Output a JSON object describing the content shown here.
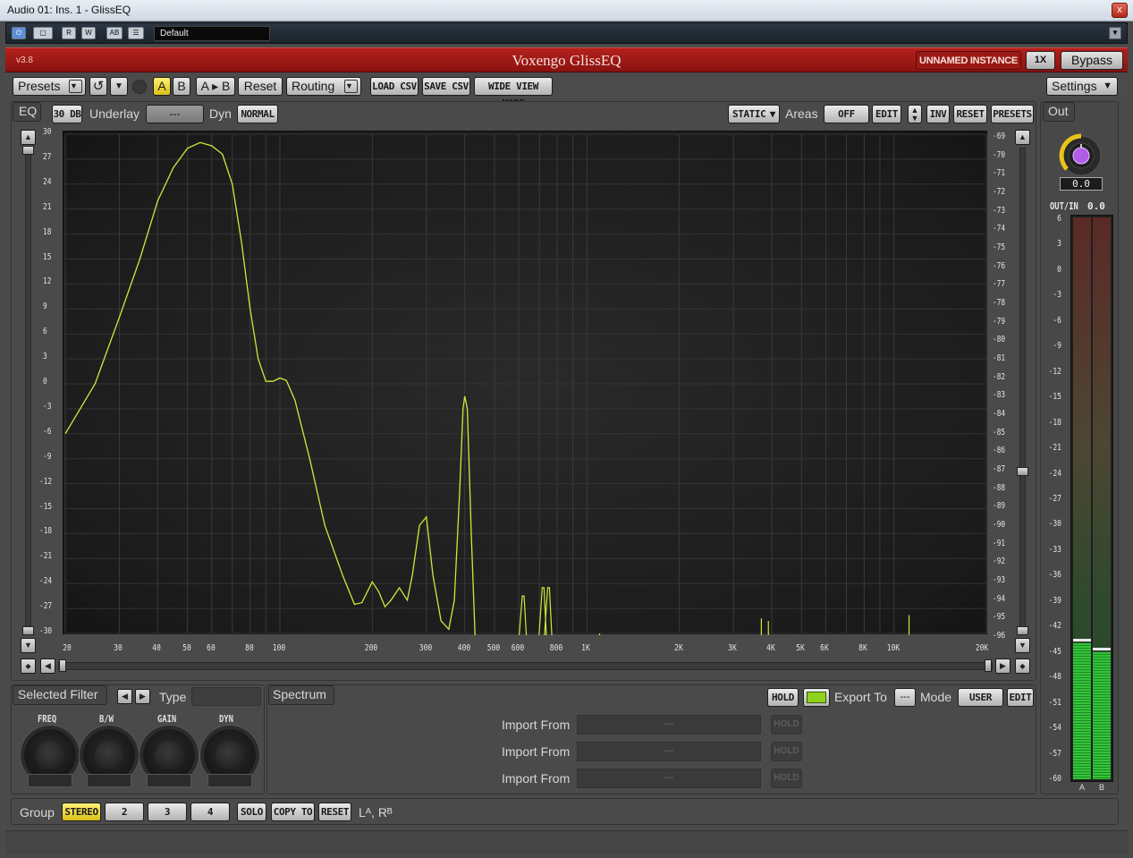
{
  "window": {
    "title": "Audio 01: Ins. 1 - GlissEQ",
    "close": "x"
  },
  "host": {
    "buttons": [
      "⏻",
      "▢",
      "R",
      "W",
      "AB",
      "☰"
    ],
    "preset": "Default"
  },
  "header": {
    "version": "v3.8",
    "name": "Voxengo GlissEQ",
    "instance": "UNNAMED INSTANCE",
    "oversample": "1X",
    "bypass": "Bypass"
  },
  "toolbar": {
    "presets": "Presets",
    "a": "A",
    "b": "B",
    "atob": "A ▸ B",
    "reset": "Reset",
    "routing": "Routing",
    "load_csv": "LOAD CSV",
    "save_csv": "SAVE CSV",
    "wide_view": "WIDE VIEW MODE",
    "settings": "Settings"
  },
  "eqbar": {
    "tab": "EQ",
    "range": "30 DB",
    "underlay_label": "Underlay",
    "underlay_value": "---",
    "dyn_label": "Dyn",
    "dyn_value": "NORMAL",
    "static": "STATIC",
    "areas_label": "Areas",
    "areas_value": "OFF",
    "edit": "EDIT",
    "inv": "INV",
    "reset": "RESET",
    "presets": "PRESETS",
    "out_tab": "Out"
  },
  "graph": {
    "left_ticks": [
      "30",
      "27",
      "24",
      "21",
      "18",
      "15",
      "12",
      "9",
      "6",
      "3",
      "0",
      "-3",
      "-6",
      "-9",
      "-12",
      "-15",
      "-18",
      "-21",
      "-24",
      "-27",
      "-30"
    ],
    "right_ticks": [
      "-69",
      "-70",
      "-71",
      "-72",
      "-73",
      "-74",
      "-75",
      "-76",
      "-77",
      "-78",
      "-79",
      "-80",
      "-81",
      "-82",
      "-83",
      "-84",
      "-85",
      "-86",
      "-87",
      "-88",
      "-89",
      "-90",
      "-91",
      "-92",
      "-93",
      "-94",
      "-95",
      "-96"
    ],
    "freq_ticks": [
      {
        "f": 20,
        "label": "20"
      },
      {
        "f": 30,
        "label": "30"
      },
      {
        "f": 40,
        "label": "40"
      },
      {
        "f": 50,
        "label": "50"
      },
      {
        "f": 60,
        "label": "60"
      },
      {
        "f": 80,
        "label": "80"
      },
      {
        "f": 100,
        "label": "100"
      },
      {
        "f": 200,
        "label": "200"
      },
      {
        "f": 300,
        "label": "300"
      },
      {
        "f": 400,
        "label": "400"
      },
      {
        "f": 500,
        "label": "500"
      },
      {
        "f": 600,
        "label": "600"
      },
      {
        "f": 800,
        "label": "800"
      },
      {
        "f": 1000,
        "label": "1K"
      },
      {
        "f": 2000,
        "label": "2K"
      },
      {
        "f": 3000,
        "label": "3K"
      },
      {
        "f": 4000,
        "label": "4K"
      },
      {
        "f": 5000,
        "label": "5K"
      },
      {
        "f": 6000,
        "label": "6K"
      },
      {
        "f": 8000,
        "label": "8K"
      },
      {
        "f": 10000,
        "label": "10K"
      },
      {
        "f": 20000,
        "label": "20K"
      }
    ],
    "curve_color": "#c8ec3c"
  },
  "out": {
    "knob_value": "0.0",
    "outin_label": "OUT/IN",
    "outin_value": "0.0",
    "scale": [
      "6",
      "3",
      "0",
      "-3",
      "-6",
      "-9",
      "-12",
      "-15",
      "-18",
      "-21",
      "-24",
      "-27",
      "-30",
      "-33",
      "-36",
      "-39",
      "-42",
      "-45",
      "-48",
      "-51",
      "-54",
      "-57",
      "-60"
    ],
    "channel_a": "A",
    "channel_b": "B",
    "level_a": -44,
    "level_b": -45
  },
  "selected_filter": {
    "tab": "Selected Filter",
    "type_label": "Type",
    "knobs": [
      "FREQ",
      "B/W",
      "GAIN",
      "DYN"
    ]
  },
  "spectrum": {
    "tab": "Spectrum",
    "hold": "HOLD",
    "export_label": "Export To",
    "export_value": "---",
    "mode_label": "Mode",
    "mode_value": "USER",
    "edit": "EDIT",
    "imports": [
      {
        "label": "Import From",
        "value": "---",
        "hold": "HOLD"
      },
      {
        "label": "Import From",
        "value": "---",
        "hold": "HOLD"
      },
      {
        "label": "Import From",
        "value": "---",
        "hold": "HOLD"
      }
    ]
  },
  "group": {
    "label": "Group",
    "stereo": "STEREO",
    "g2": "2",
    "g3": "3",
    "g4": "4",
    "solo": "SOLO",
    "copy_to": "COPY TO",
    "reset": "RESET",
    "channels": "Lᴬ, Rᴮ"
  }
}
